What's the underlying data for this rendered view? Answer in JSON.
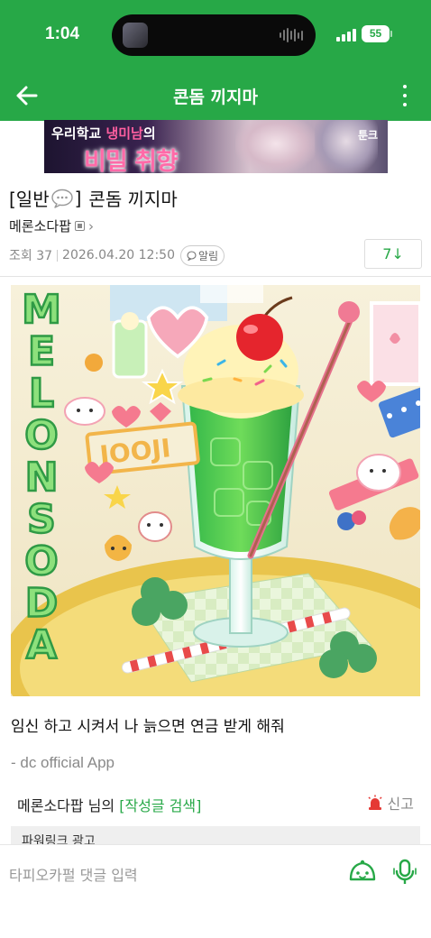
{
  "status_bar": {
    "time": "1:04",
    "battery": "55"
  },
  "header": {
    "title": "콘돔 끼지마"
  },
  "banner_ad": {
    "line1_prefix": "우리학교 ",
    "line1_highlight": "냉미남",
    "line1_suffix": "의",
    "line2": "비밀 취향",
    "logo": "툰크"
  },
  "post": {
    "category": "[일반",
    "category_close": "]",
    "title": "콘돔 끼지마",
    "author": "메론소다팝",
    "views_label": "조회 37",
    "datetime": "2026.04.20 12:50",
    "alarm_label": "알림",
    "comment_jump": "7↓",
    "illustration": {
      "vertical_text": "MELONSODA",
      "sign_text": "JOOJI"
    },
    "body": "임신 하고 시켜서 나 늙으면 연금 받게 해줘",
    "signature": "- dc official App",
    "author_search_prefix": "메론소다팝 님의 ",
    "author_search_link": "[작성글 검색]",
    "report_label": "신고"
  },
  "powerlink": {
    "label": "파워링크 광고"
  },
  "comment_bar": {
    "placeholder": "타피오카펄 댓글 입력"
  },
  "colors": {
    "brand": "#27a847",
    "report_red": "#e53935"
  }
}
